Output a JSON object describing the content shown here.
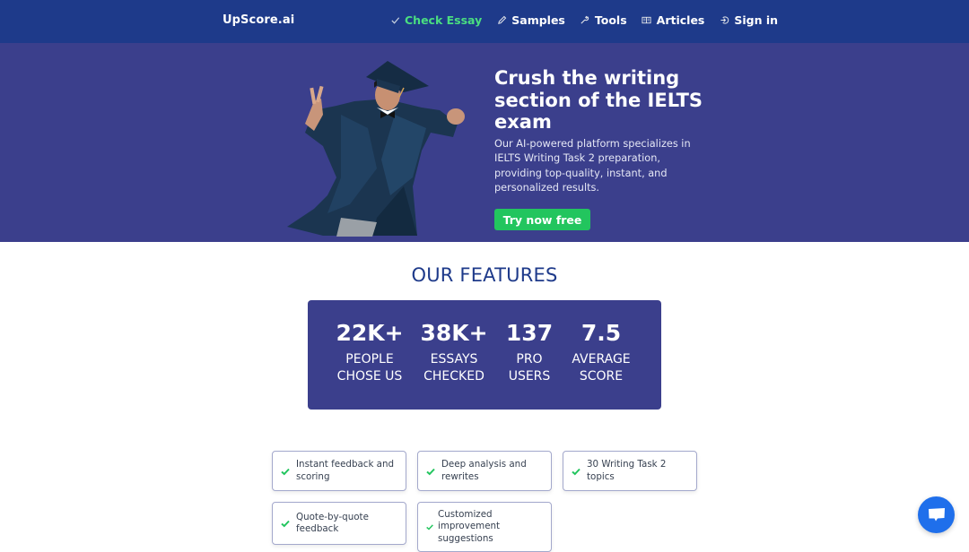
{
  "nav": {
    "brand": "UpScore.ai",
    "links": [
      {
        "label": "Check Essay",
        "icon": "check-icon",
        "active": true
      },
      {
        "label": "Samples",
        "icon": "pencil-icon",
        "active": false
      },
      {
        "label": "Tools",
        "icon": "wrench-icon",
        "active": false
      },
      {
        "label": "Articles",
        "icon": "book-icon",
        "active": false
      },
      {
        "label": "Sign in",
        "icon": "sign-in-icon",
        "active": false
      }
    ]
  },
  "hero": {
    "title": "Crush the writing section of the IELTS exam",
    "description": "Our AI-powered platform specializes in IELTS Writing Task 2 preparation, providing top-quality, instant, and personalized results.",
    "cta_label": "Try now free",
    "image_alt": "graduate-celebrating"
  },
  "features": {
    "title": "OUR FEATURES",
    "stats": [
      {
        "value": "22K+",
        "label": "PEOPLE\nCHOSE US"
      },
      {
        "value": "38K+",
        "label": "ESSAYS\nCHECKED"
      },
      {
        "value": "137",
        "label": "PRO\nUSERS"
      },
      {
        "value": "7.5",
        "label": "AVERAGE\nSCORE"
      }
    ],
    "cards": [
      {
        "text": "Instant feedback and scoring"
      },
      {
        "text": "Deep analysis and rewrites"
      },
      {
        "text": "30 Writing Task 2 topics"
      },
      {
        "text": "Quote-by-quote feedback"
      },
      {
        "text": "Customized improvement suggestions"
      }
    ]
  },
  "colors": {
    "nav_bg": "#1e3a8a",
    "hero_bg": "#3b3f8c",
    "accent_green": "#22c55e",
    "active_link": "#4ade80",
    "chat_button": "#1f6feb"
  },
  "chat": {
    "icon": "chat-icon"
  }
}
